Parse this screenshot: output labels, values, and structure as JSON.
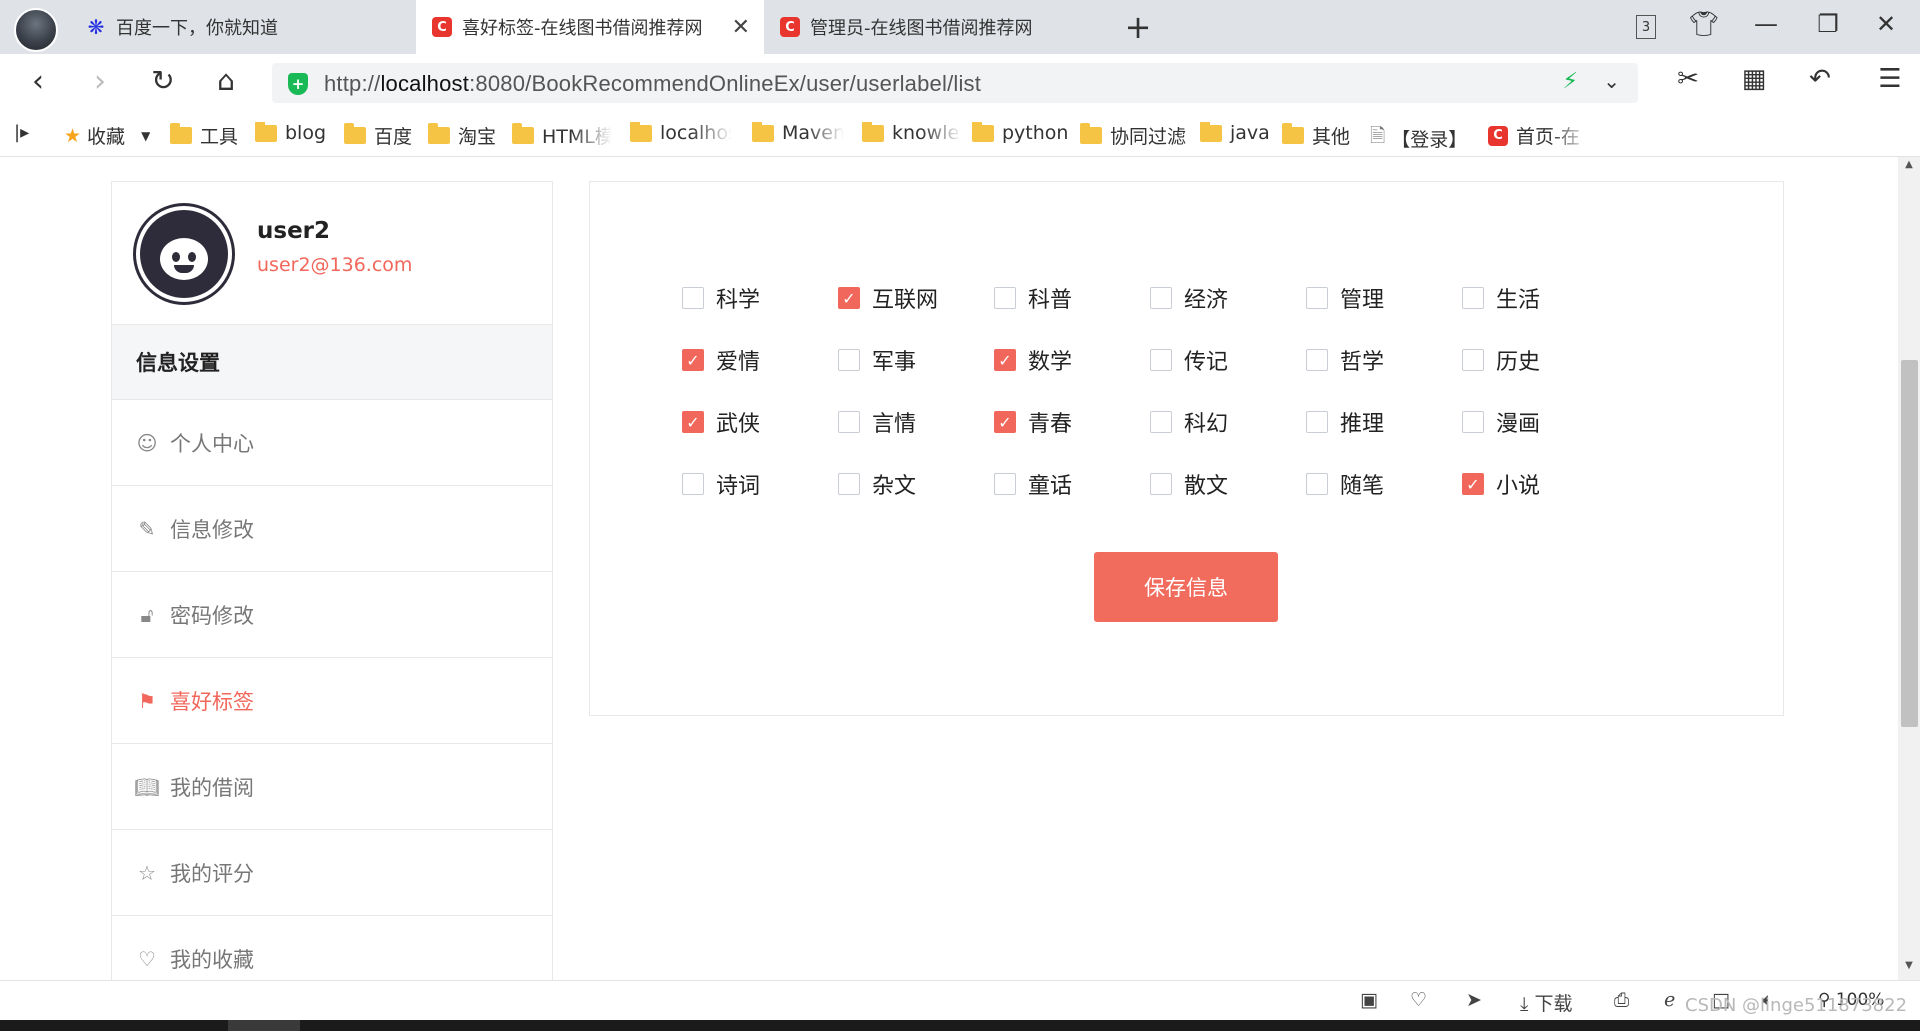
{
  "browser": {
    "tabs": [
      {
        "title": "百度一下，你就知道",
        "icon": "baidu-paw-icon"
      },
      {
        "title": "喜好标签-在线图书借阅推荐网",
        "icon": "site-c-icon",
        "active": true
      },
      {
        "title": "管理员-在线图书借阅推荐网",
        "icon": "site-c-icon"
      }
    ],
    "tab_count": "3",
    "url": {
      "scheme": "http://",
      "host": "localhost",
      "rest": ":8080/BookRecommendOnlineEx/user/userlabel/list"
    },
    "bookmarks": [
      {
        "label": "收藏",
        "type": "star"
      },
      {
        "label": "工具",
        "type": "folder"
      },
      {
        "label": "blog",
        "type": "folder"
      },
      {
        "label": "百度",
        "type": "folder"
      },
      {
        "label": "淘宝",
        "type": "folder"
      },
      {
        "label": "HTML模",
        "type": "folder"
      },
      {
        "label": "localhos",
        "type": "folder"
      },
      {
        "label": "Maven",
        "type": "folder"
      },
      {
        "label": "knowle",
        "type": "folder"
      },
      {
        "label": "python",
        "type": "folder"
      },
      {
        "label": "协同过滤",
        "type": "folder"
      },
      {
        "label": "java",
        "type": "folder"
      },
      {
        "label": "其他",
        "type": "folder"
      },
      {
        "label": "【登录】",
        "type": "page"
      },
      {
        "label": "首页-在",
        "type": "site"
      }
    ],
    "status": {
      "download": "下载",
      "zoom": "100%",
      "watermark": "CSDN @linge511873822"
    }
  },
  "sidebar": {
    "username": "user2",
    "email": "user2@136.com",
    "section_title": "信息设置",
    "items": [
      {
        "label": "个人中心",
        "icon": "user-circle-icon"
      },
      {
        "label": "信息修改",
        "icon": "edit-icon"
      },
      {
        "label": "密码修改",
        "icon": "unlock-icon"
      },
      {
        "label": "喜好标签",
        "icon": "bookmark-icon",
        "active": true
      },
      {
        "label": "我的借阅",
        "icon": "book-open-icon"
      },
      {
        "label": "我的评分",
        "icon": "star-icon"
      },
      {
        "label": "我的收藏",
        "icon": "heart-icon"
      }
    ]
  },
  "labels": [
    {
      "name": "科学",
      "checked": false
    },
    {
      "name": "互联网",
      "checked": true
    },
    {
      "name": "科普",
      "checked": false
    },
    {
      "name": "经济",
      "checked": false
    },
    {
      "name": "管理",
      "checked": false
    },
    {
      "name": "生活",
      "checked": false
    },
    {
      "name": "爱情",
      "checked": true
    },
    {
      "name": "军事",
      "checked": false
    },
    {
      "name": "数学",
      "checked": true
    },
    {
      "name": "传记",
      "checked": false
    },
    {
      "name": "哲学",
      "checked": false
    },
    {
      "name": "历史",
      "checked": false
    },
    {
      "name": "武侠",
      "checked": true
    },
    {
      "name": "言情",
      "checked": false
    },
    {
      "name": "青春",
      "checked": true
    },
    {
      "name": "科幻",
      "checked": false
    },
    {
      "name": "推理",
      "checked": false
    },
    {
      "name": "漫画",
      "checked": false
    },
    {
      "name": "诗词",
      "checked": false
    },
    {
      "name": "杂文",
      "checked": false
    },
    {
      "name": "童话",
      "checked": false
    },
    {
      "name": "散文",
      "checked": false
    },
    {
      "name": "随笔",
      "checked": false
    },
    {
      "name": "小说",
      "checked": true
    }
  ],
  "save_button": "保存信息",
  "colors": {
    "accent": "#f2675b",
    "tabbar": "#dfe3e8",
    "secure": "#19b955"
  }
}
